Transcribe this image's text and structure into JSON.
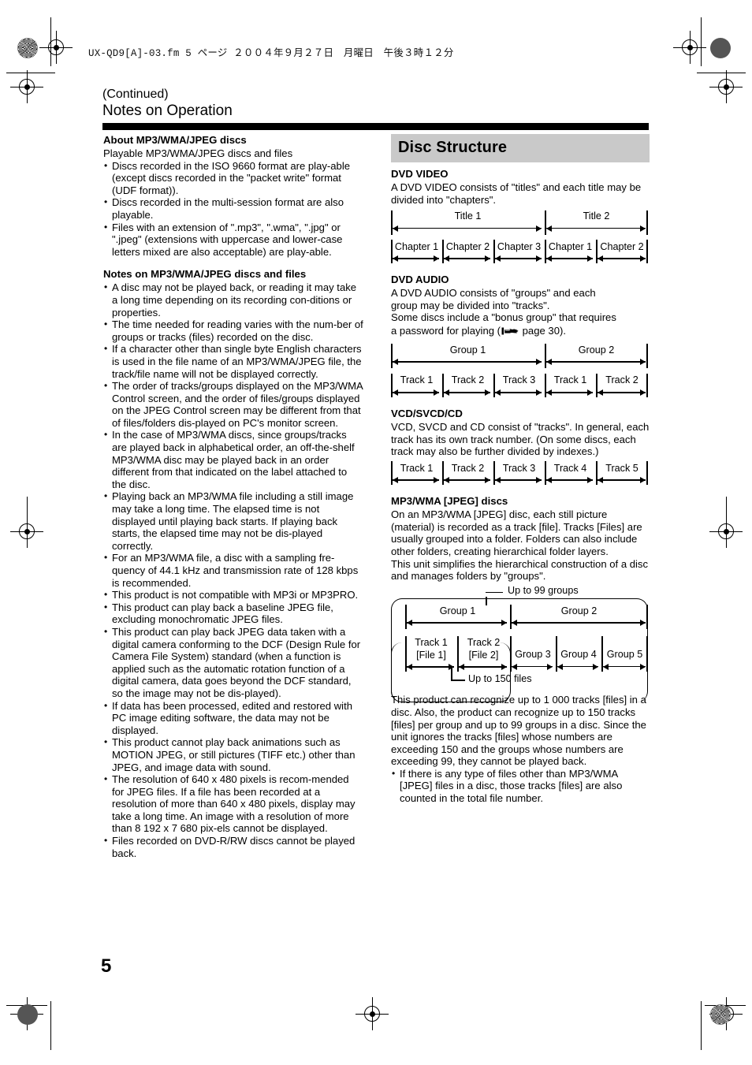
{
  "print_header": {
    "text": "UX-QD9[A]-03.fm  5 ページ  ２００４年９月２７日　月曜日　午後３時１２分"
  },
  "header": {
    "continued": "(Continued)",
    "title": "Notes on Operation"
  },
  "page_number": "5",
  "left_column": {
    "section1_heading": "About MP3/WMA/JPEG discs",
    "section1_intro": "Playable MP3/WMA/JPEG discs and files",
    "section1_bullets": [
      "Discs recorded in the ISO 9660 format are play-able (except discs recorded in the \"packet write\" format (UDF format)).",
      "Discs recorded in the multi-session format are also playable.",
      "Files with an extension of \".mp3\", \".wma\", \".jpg\" or \".jpeg\" (extensions with uppercase and lower-case letters mixed are also acceptable) are play-able."
    ],
    "section2_heading": "Notes on MP3/WMA/JPEG discs and files",
    "section2_bullets": [
      "A disc may not be played back, or reading it may take a long time depending on its recording con-ditions or properties.",
      "The time needed for reading varies with the num-ber of groups or tracks (files) recorded on the disc.",
      "If a character other than single byte English characters is used in the file name of an MP3/WMA/JPEG file, the track/file name will not be displayed correctly.",
      "The order of tracks/groups displayed on the MP3/WMA Control screen, and the order of files/groups displayed on the JPEG Control screen may be different from that of files/folders dis-played on PC's monitor screen.",
      "In the case of MP3/WMA discs, since groups/tracks are played back in alphabetical order, an off-the-shelf MP3/WMA disc may be played back in an order different from that indicated on the label attached to the disc.",
      "Playing back an MP3/WMA file including a still image may take a long time. The elapsed time is not displayed until playing back starts. If playing back starts, the elapsed time may not be dis-played correctly.",
      "For an MP3/WMA file, a disc with a sampling fre-quency of 44.1 kHz and transmission rate of 128 kbps is recommended.",
      "This product is not compatible with MP3i or MP3PRO.",
      "This product can play back a baseline JPEG file, excluding monochromatic JPEG files.",
      "This product can play back JPEG data taken with a digital camera conforming to the DCF (Design Rule for Camera File System) standard (when a function is applied such as the automatic rotation function of a digital camera, data goes beyond the DCF standard, so the image may not be dis-played).",
      "If data has been processed, edited and restored with PC image editing software, the data may not be displayed.",
      "This product cannot play back animations such as MOTION JPEG, or still pictures (TIFF etc.) other than JPEG, and image data with sound.",
      "The resolution of 640 x 480 pixels is recom-mended for JPEG files. If a file has been recorded at a resolution of more than 640 x 480 pixels, display may take a long time. An image with a resolution of more than 8 192 x 7 680 pix-els cannot be displayed.",
      "Files recorded on DVD-R/RW discs cannot be played back."
    ]
  },
  "right_column": {
    "banner_title": "Disc Structure",
    "dvd_video": {
      "heading": "DVD VIDEO",
      "body": "A DVD VIDEO consists of \"titles\" and each title may be divided into \"chapters\".",
      "row_titles": [
        "Title 1",
        "Title 2"
      ],
      "row_chapters": [
        "Chapter 1",
        "Chapter 2",
        "Chapter 3",
        "Chapter 1",
        "Chapter 2"
      ]
    },
    "dvd_audio": {
      "heading": "DVD AUDIO",
      "body_line1": "A DVD AUDIO consists of \"groups\" and each",
      "body_line2": "group may be divided into \"tracks\".",
      "body_line3": "Some discs include a \"bonus group\" that requires",
      "body_line4_pre": "a password for playing (",
      "body_line4_post": " page 30).",
      "icon": "pointing-hand-icon",
      "row_groups": [
        "Group 1",
        "Group 2"
      ],
      "row_tracks": [
        "Track 1",
        "Track 2",
        "Track 3",
        "Track 1",
        "Track 2"
      ]
    },
    "vcd": {
      "heading": "VCD/SVCD/CD",
      "body": "VCD, SVCD and CD consist of \"tracks\". In general, each track has its own track number. (On some discs, each track may also be further divided by indexes.)",
      "row_tracks": [
        "Track 1",
        "Track 2",
        "Track 3",
        "Track 4",
        "Track 5"
      ]
    },
    "mp3": {
      "heading": "MP3/WMA [JPEG] discs",
      "body1": "On an MP3/WMA [JPEG] disc, each still picture (material) is recorded as a track [file]. Tracks [Files] are usually grouped into a folder. Folders can also include other folders, creating hierarchical folder layers.",
      "body2": "This unit simplifies the hierarchical construction of a disc and manages folders by \"groups\".",
      "caption_top": "Up to 99 groups",
      "caption_bottom": "Up to 150 files",
      "row_groups": [
        "Group 1",
        "Group 2"
      ],
      "row_tracks": [
        {
          "line1": "Track 1",
          "line2": "[File 1]"
        },
        {
          "line1": "Track 2",
          "line2": "[File 2]"
        },
        {
          "line1": "Group 3",
          "line2": ""
        },
        {
          "line1": "Group 4",
          "line2": ""
        },
        {
          "line1": "Group 5",
          "line2": ""
        }
      ],
      "closing_body": "This product can recognize up to 1 000 tracks [files] in a disc. Also, the product can recognize up to 150 tracks [files] per group and up to 99 groups in a disc. Since the unit ignores the tracks [files] whose numbers are exceeding 150 and the groups whose numbers are exceeding 99, they cannot be played back.",
      "closing_bullet": "If there is any type of files other than MP3/WMA [JPEG] files in a disc, those tracks [files] are also counted in the total file number."
    }
  }
}
